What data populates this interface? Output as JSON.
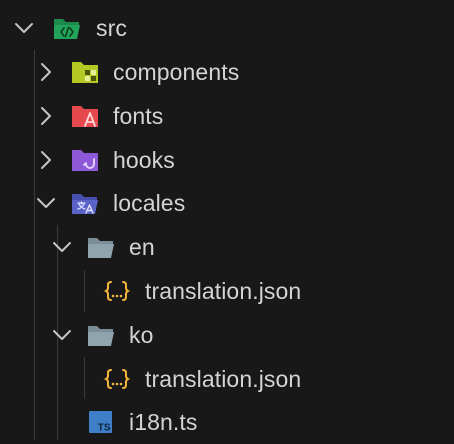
{
  "explorer": {
    "root": {
      "label": "src",
      "icon": "folder-src-open-icon",
      "expanded": true
    },
    "items": [
      {
        "label": "components",
        "icon": "folder-components-icon",
        "expanded": false
      },
      {
        "label": "fonts",
        "icon": "folder-fonts-icon",
        "expanded": false
      },
      {
        "label": "hooks",
        "icon": "folder-hooks-icon",
        "expanded": false
      },
      {
        "label": "locales",
        "icon": "folder-locales-open-icon",
        "expanded": true,
        "children": [
          {
            "label": "en",
            "icon": "folder-open-icon",
            "expanded": true,
            "children": [
              {
                "label": "translation.json",
                "icon": "json-file-icon"
              }
            ]
          },
          {
            "label": "ko",
            "icon": "folder-open-icon",
            "expanded": true,
            "children": [
              {
                "label": "translation.json",
                "icon": "json-file-icon"
              }
            ]
          },
          {
            "label": "i18n.ts",
            "icon": "typescript-file-icon"
          }
        ]
      }
    ]
  },
  "colors": {
    "background": "#181818",
    "text": "#d4d4d4",
    "chevron": "#c5c5c5",
    "indent_guide": "#3a3a3a",
    "folder_src": "#22a35a",
    "folder_components": "#b5c925",
    "folder_fonts": "#e5484d",
    "folder_hooks": "#8e59d8",
    "folder_locales": "#5a62c7",
    "folder_plain": "#90a4ae",
    "json_brace": "#f2b63b",
    "typescript": "#3f7fc7"
  }
}
